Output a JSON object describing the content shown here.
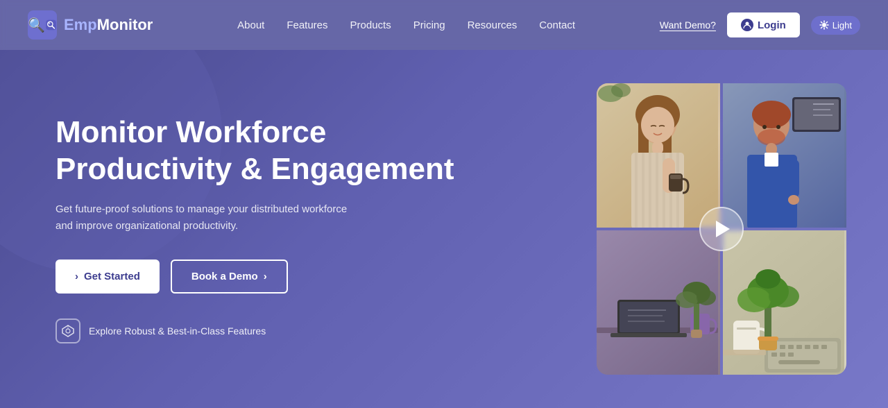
{
  "header": {
    "logo": {
      "emp": "Emp",
      "monitor": "Monitor"
    },
    "nav": {
      "about": "About",
      "features": "Features",
      "products": "Products",
      "pricing": "Pricing",
      "resources": "Resources",
      "contact": "Contact"
    },
    "want_demo": "Want Demo?",
    "login_label": "Login",
    "light_toggle": "Light"
  },
  "hero": {
    "title_line1": "Monitor  Workforce",
    "title_line2": "Productivity & Engagement",
    "subtitle": "Get future-proof solutions to manage your distributed workforce and improve organizational productivity.",
    "get_started": "Get Started",
    "book_demo": "Book a Demo",
    "explore_label": "Explore Robust & Best-in-Class Features",
    "get_started_arrow": "›",
    "book_demo_arrow": "›"
  },
  "colors": {
    "bg_gradient_start": "#4a4a8f",
    "bg_gradient_end": "#7878c8",
    "accent": "#6060b0",
    "white": "#ffffff",
    "logo_accent": "#a8b4ff"
  }
}
